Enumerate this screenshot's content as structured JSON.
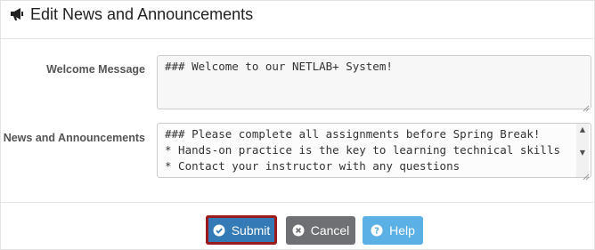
{
  "panel": {
    "title": "Edit News and Announcements",
    "icon": "bullhorn-icon"
  },
  "welcome": {
    "label": "Welcome Message",
    "value": "### Welcome to our NETLAB+ System!"
  },
  "news": {
    "label": "News and Announcements",
    "value": "### Please complete all assignments before Spring Break!\n* Hands-on practice is the key to learning technical skills\n* Contact your instructor with any questions"
  },
  "buttons": {
    "submit": {
      "label": "Submit",
      "icon": "check-circle-icon",
      "color": "#337ab7"
    },
    "cancel": {
      "label": "Cancel",
      "icon": "times-circle-icon",
      "color": "#6f7074"
    },
    "help": {
      "label": "Help",
      "icon": "question-circle-icon",
      "color": "#5bb0e6"
    }
  },
  "colors": {
    "focus_outline": "#9b1b1b"
  }
}
